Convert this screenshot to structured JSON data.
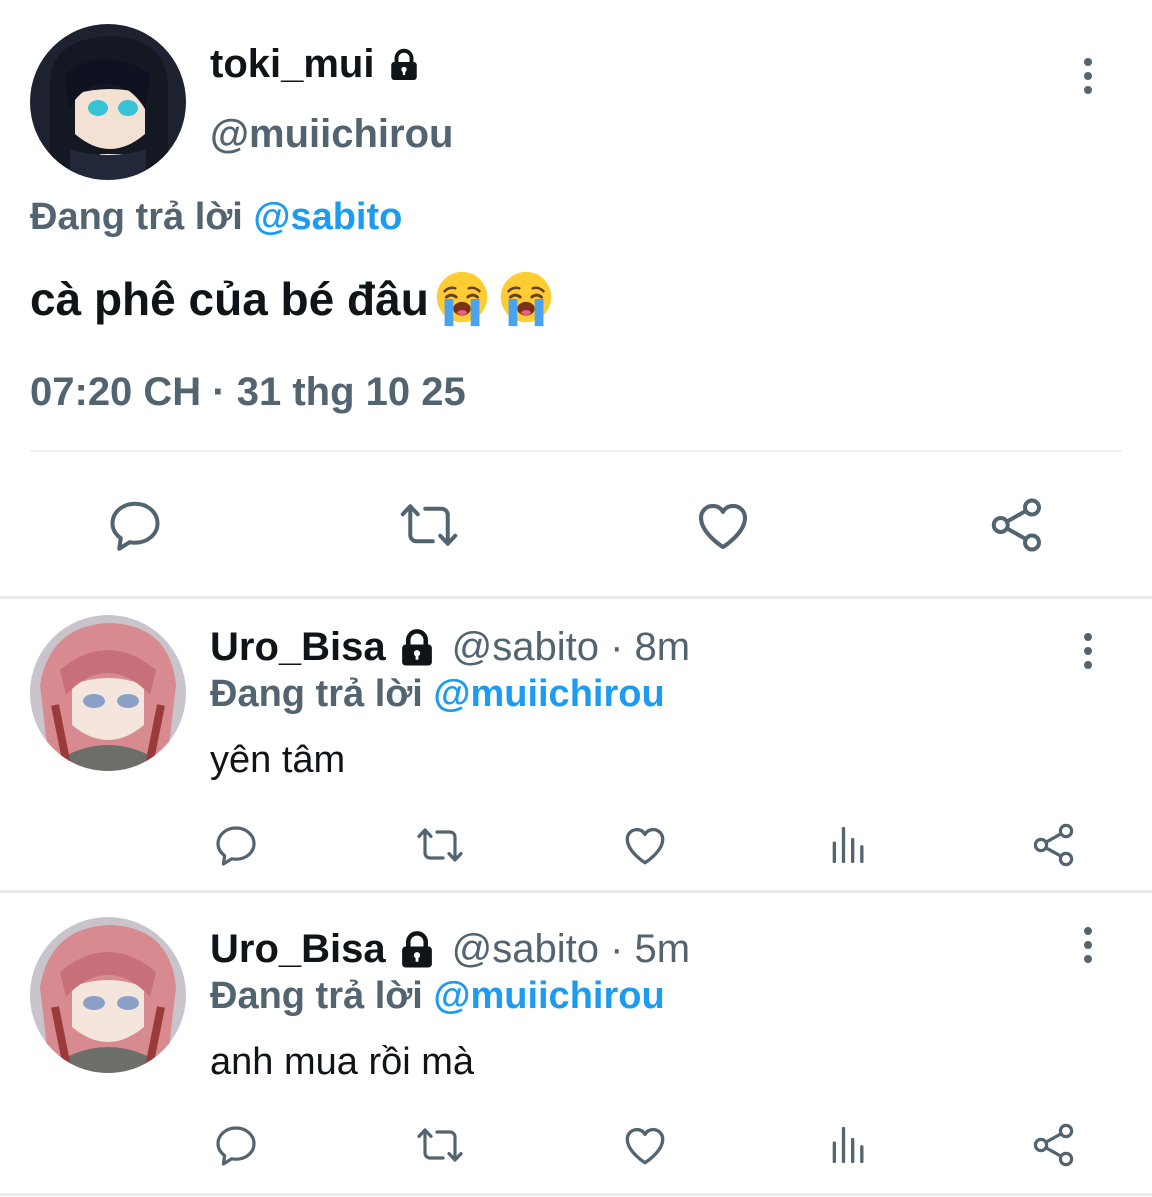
{
  "main_tweet": {
    "display_name": "toki_mui",
    "handle": "@muiichirou",
    "replying_prefix": "Đang trả lời",
    "replying_to": "@sabito",
    "text": "cà phê của bé đâu",
    "emojis": [
      "loudly-crying-face",
      "loudly-crying-face"
    ],
    "timestamp": "07:20 CH · 31 thg 10 25",
    "actions": [
      "reply-icon",
      "retweet-icon",
      "like-icon",
      "share-icon"
    ]
  },
  "replies": [
    {
      "display_name": "Uro_Bisa",
      "handle_time": "@sabito · 8m",
      "replying_prefix": "Đang trả lời",
      "replying_to": "@muiichirou",
      "text": "yên tâm",
      "actions": [
        "reply-icon",
        "retweet-icon",
        "like-icon",
        "analytics-icon",
        "share-icon"
      ]
    },
    {
      "display_name": "Uro_Bisa",
      "handle_time": "@sabito · 5m",
      "replying_prefix": "Đang trả lời",
      "replying_to": "@muiichirou",
      "text": "anh mua rồi mà",
      "actions": [
        "reply-icon",
        "retweet-icon",
        "like-icon",
        "analytics-icon",
        "share-icon"
      ]
    }
  ],
  "colors": {
    "text": "#0f1419",
    "secondary": "#536471",
    "link": "#1d9bf0",
    "divider": "#eff3f4"
  }
}
